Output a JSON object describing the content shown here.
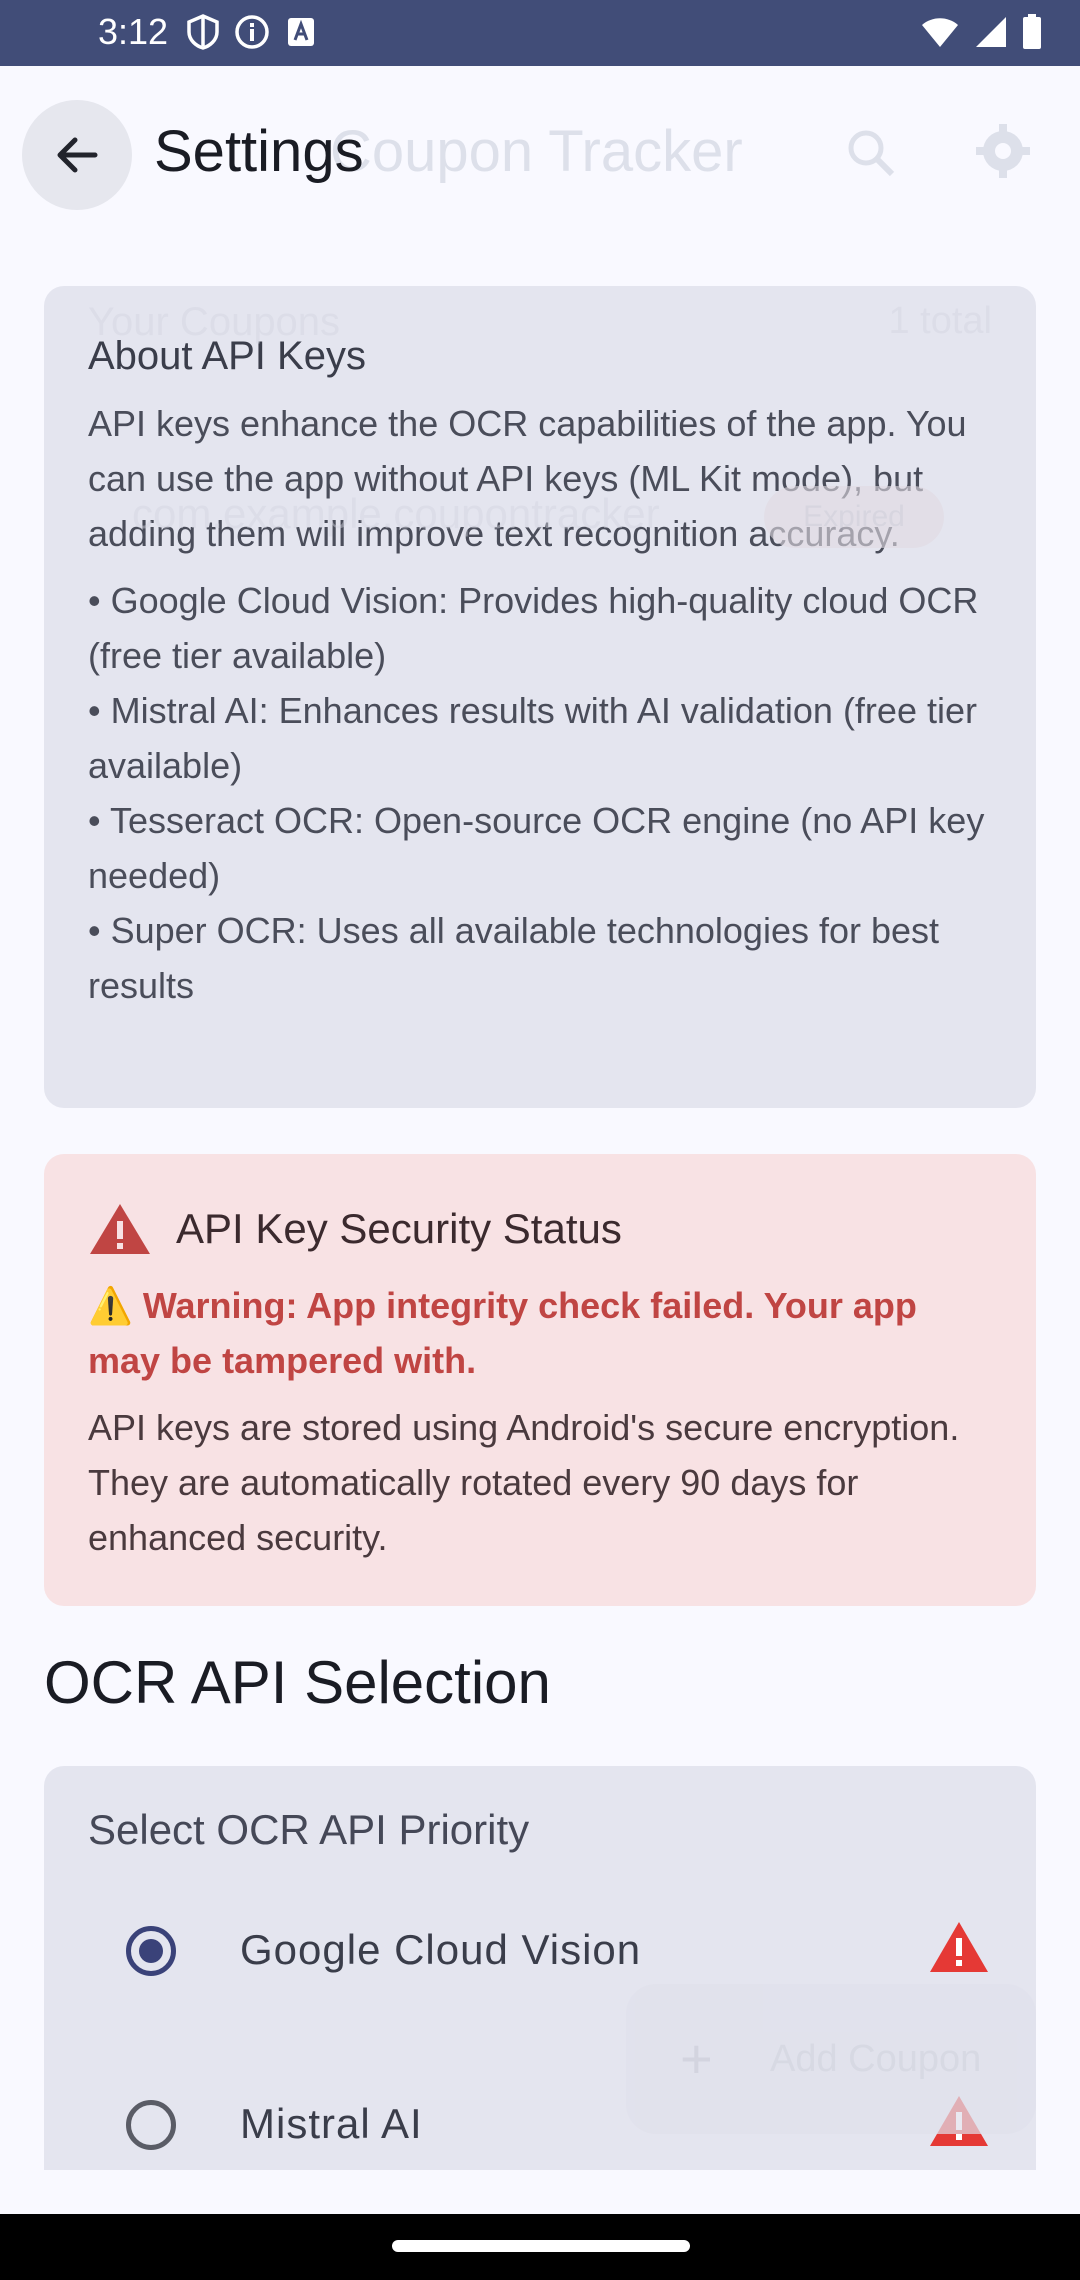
{
  "status_bar": {
    "time": "3:12"
  },
  "appbar": {
    "title": "Settings",
    "background_title": "Coupon Tracker"
  },
  "background": {
    "coupons_header": "Your Coupons",
    "coupons_total": "1 total",
    "coupon_name": "com.example.coupontracker",
    "coupon_badge": "Expired",
    "fab_label": "Add Coupon"
  },
  "about_card": {
    "title": "About API Keys",
    "paragraph": "API keys enhance the OCR capabilities of the app. You can use the app without API keys (ML Kit mode), but adding them will improve text recognition accuracy.",
    "bullets": [
      "• Google Cloud Vision: Provides high-quality cloud OCR (free tier available)",
      "• Mistral AI: Enhances results with AI validation (free tier available)",
      "• Tesseract OCR: Open-source OCR engine (no API key needed)",
      "• Super OCR: Uses all available technologies for best results"
    ]
  },
  "security_card": {
    "title": "API Key Security Status",
    "warning": "⚠️ Warning: App integrity check failed. Your app may be tampered with.",
    "description": "API keys are stored using Android's secure encryption. They are automatically rotated every 90 days for enhanced security."
  },
  "ocr_section": {
    "heading": "OCR API Selection",
    "card_title": "Select OCR API Priority",
    "options": [
      {
        "label": "Google Cloud Vision",
        "selected": true
      },
      {
        "label": "Mistral AI",
        "selected": false
      }
    ]
  },
  "colors": {
    "status_bar": "#414d78",
    "warning_red": "#c04543",
    "radio_accent": "#3a4279"
  }
}
